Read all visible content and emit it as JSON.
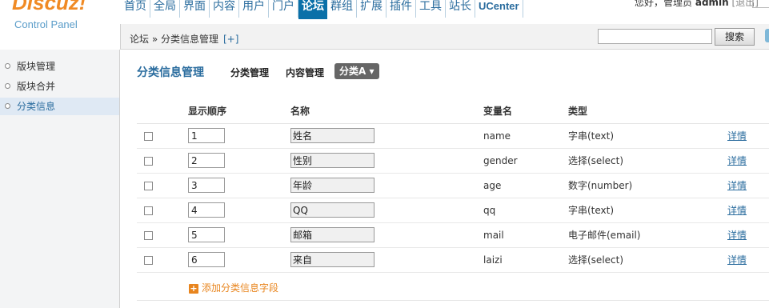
{
  "logo": {
    "brand": "Discuz!",
    "sub": "Control Panel"
  },
  "topnav": [
    {
      "label": "首页"
    },
    {
      "label": "全局"
    },
    {
      "label": "界面"
    },
    {
      "label": "内容"
    },
    {
      "label": "用户"
    },
    {
      "label": "门户"
    },
    {
      "label": "论坛"
    },
    {
      "label": "群组"
    },
    {
      "label": "扩展"
    },
    {
      "label": "插件"
    },
    {
      "label": "工具"
    },
    {
      "label": "站长"
    },
    {
      "label": "UCenter"
    }
  ],
  "topnav_active": "论坛",
  "user": {
    "greeting": "您好，管理员",
    "name": "admin",
    "logout": "[退出]"
  },
  "breadcrumb": {
    "path": "论坛 » 分类信息管理",
    "plus": "[+]"
  },
  "search": {
    "button": "搜索",
    "value": ""
  },
  "sidebar": [
    {
      "label": "版块管理",
      "active": false
    },
    {
      "label": "版块合并",
      "active": false
    },
    {
      "label": "分类信息",
      "active": true
    }
  ],
  "tabs": {
    "title": "分类信息管理",
    "items": [
      "分类管理",
      "内容管理"
    ],
    "dropdown": "分类A ▾"
  },
  "table": {
    "headers": [
      "",
      "显示顺序",
      "名称",
      "变量名",
      "类型",
      ""
    ],
    "rows": [
      {
        "order": "1",
        "name": "姓名",
        "var": "name",
        "type": "字串(text)",
        "action": "详情"
      },
      {
        "order": "2",
        "name": "性别",
        "var": "gender",
        "type": "选择(select)",
        "action": "详情"
      },
      {
        "order": "3",
        "name": "年龄",
        "var": "age",
        "type": "数字(number)",
        "action": "详情"
      },
      {
        "order": "4",
        "name": "QQ",
        "var": "qq",
        "type": "字串(text)",
        "action": "详情"
      },
      {
        "order": "5",
        "name": "邮箱",
        "var": "mail",
        "type": "电子邮件(email)",
        "action": "详情"
      },
      {
        "order": "6",
        "name": "来自",
        "var": "laizi",
        "type": "选择(select)",
        "action": "详情"
      }
    ]
  },
  "add_link": "添加分类信息字段",
  "colors": {
    "accent": "#0a70a8",
    "link": "#2a6c9e",
    "orange": "#e8851e",
    "brand": "#f08a24"
  }
}
